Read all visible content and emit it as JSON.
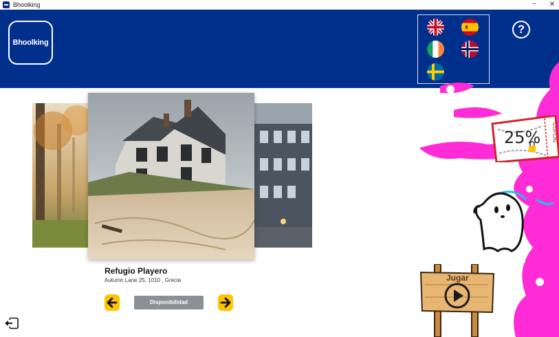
{
  "window": {
    "title": "Bhoolking",
    "minimize_glyph": "−",
    "close_glyph": "✕"
  },
  "header": {
    "logo_text": "Bhoolking",
    "help_glyph": "?",
    "languages": [
      {
        "code": "en",
        "icon": "uk-flag-icon"
      },
      {
        "code": "es",
        "icon": "spain-flag-icon"
      },
      {
        "code": "ga",
        "icon": "ireland-flag-icon"
      },
      {
        "code": "no",
        "icon": "norway-flag-icon"
      },
      {
        "code": "sv",
        "icon": "sweden-flag-icon"
      }
    ]
  },
  "listing": {
    "name": "Refugio Playero",
    "address": "Autumn Lane 25, 1010 , Grecia"
  },
  "actions": {
    "availability_label": "Disponibilidad"
  },
  "promo": {
    "coupon_text": "25%",
    "coupon_side_text": "CUPON",
    "play_label": "Jugar"
  },
  "colors": {
    "header_bg": "#012f8c",
    "arrow_bg": "#ffc400",
    "button_bg": "#8b8f96",
    "slime": "#ff2bd6"
  }
}
